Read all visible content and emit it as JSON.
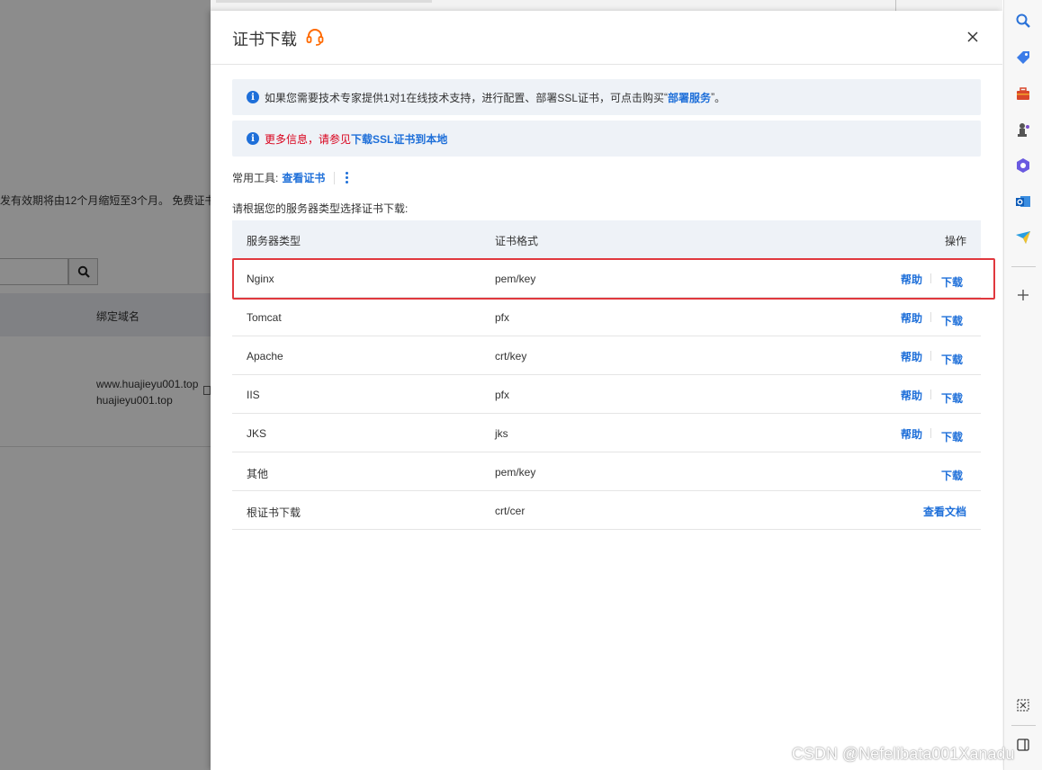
{
  "background": {
    "notice": "发有效期将由12个月缩短至3个月。 免费证书",
    "table_header": "绑定域名",
    "domains": [
      "www.huajieyu001.top",
      "huajieyu001.top"
    ]
  },
  "drawer": {
    "title": "证书下载",
    "notice1": {
      "text_before": "如果您需要技术专家提供1对1在线技术支持，进行配置、部署SSL证书，可点击购买",
      "link": "部署服务",
      "text_after": "。"
    },
    "notice2": {
      "text": "更多信息，请参见",
      "link": "下载SSL证书到本地"
    },
    "tools_label": "常用工具:",
    "tools_link": "查看证书",
    "choose_text": "请根据您的服务器类型选择证书下载:",
    "table": {
      "headers": {
        "server": "服务器类型",
        "format": "证书格式",
        "action": "操作"
      },
      "rows": [
        {
          "server": "Nginx",
          "format": "pem/key",
          "help": "帮助",
          "download": "下载"
        },
        {
          "server": "Tomcat",
          "format": "pfx",
          "help": "帮助",
          "download": "下载"
        },
        {
          "server": "Apache",
          "format": "crt/key",
          "help": "帮助",
          "download": "下载"
        },
        {
          "server": "IIS",
          "format": "pfx",
          "help": "帮助",
          "download": "下载"
        },
        {
          "server": "JKS",
          "format": "jks",
          "help": "帮助",
          "download": "下载"
        },
        {
          "server": "其他",
          "format": "pem/key",
          "download": "下载"
        },
        {
          "server": "根证书下载",
          "format": "crt/cer",
          "doc": "查看文档"
        }
      ]
    }
  },
  "watermark": "CSDN @Nefelibata001Xanadu",
  "colors": {
    "link": "#1e6fd9",
    "highlight": "#e0383e",
    "notice_bg": "#eef2f7",
    "alert_text": "#d9001b"
  },
  "sidebar_icons": [
    "search-icon",
    "tag-icon",
    "briefcase-icon",
    "chess-icon",
    "copilot-icon",
    "outlook-icon",
    "send-icon",
    "add-icon",
    "screenshot-icon",
    "sidebar-toggle-icon"
  ]
}
